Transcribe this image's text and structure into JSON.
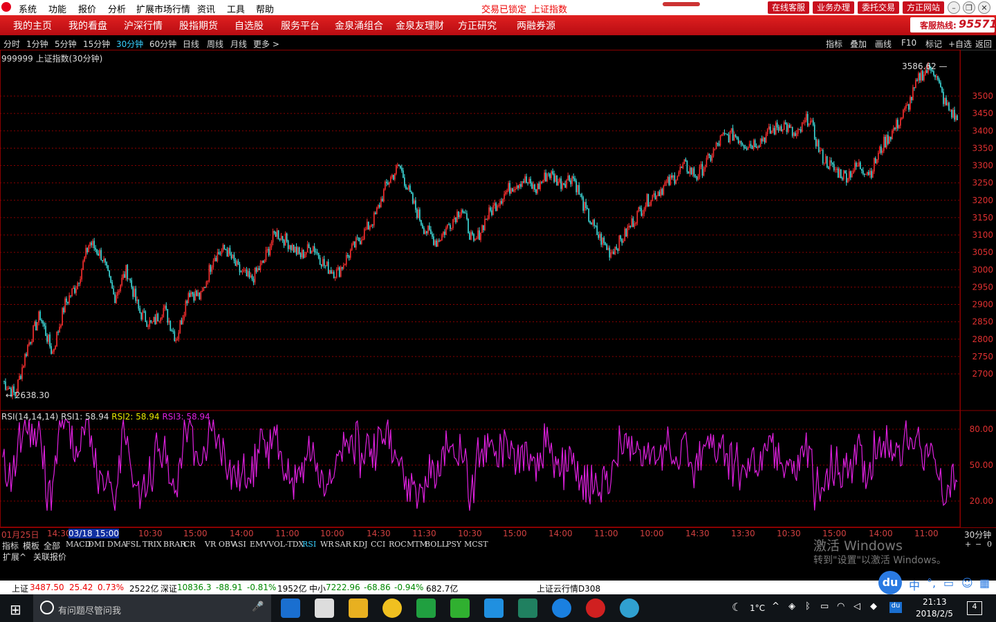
{
  "menu": {
    "items": [
      "系统",
      "功能",
      "报价",
      "分析",
      "扩展市场行情",
      "资讯",
      "工具",
      "帮助"
    ],
    "status_locked": "交易已锁定",
    "status_index": "上证指数",
    "buttons": [
      "在线客服",
      "业务办理",
      "委托交易",
      "方正网站"
    ]
  },
  "nav": {
    "items": [
      "我的主页",
      "我的看盘",
      "沪深行情",
      "股指期货",
      "自选股",
      "服务平台",
      "金泉涌组合",
      "金泉友理财",
      "方正研究",
      "两融券源"
    ],
    "hotline_label": "客服热线:",
    "hotline_number": "95571"
  },
  "periods": {
    "items": [
      "分时",
      "1分钟",
      "5分钟",
      "15分钟",
      "30分钟",
      "60分钟",
      "日线",
      "周线",
      "月线",
      "更多 >"
    ],
    "active": "30分钟",
    "tools": [
      "指标",
      "叠加",
      "画线",
      "F10",
      "标记",
      "+自选",
      "返回"
    ]
  },
  "chart_data": [
    {
      "type": "candlestick",
      "title": "999999 上证指数(30分钟)",
      "ylim": [
        2600,
        3620
      ],
      "y_ticks": [
        "3500",
        "3450",
        "3400",
        "3350",
        "3300",
        "3250",
        "3200",
        "3150",
        "3100",
        "3050",
        "3000",
        "2950",
        "2900",
        "2850",
        "2800",
        "2750",
        "2700"
      ],
      "high_label": "3586.62",
      "low_label": "2638.30",
      "approx_path": [
        2680,
        2640,
        2780,
        2870,
        2760,
        2900,
        2960,
        3080,
        3040,
        2920,
        3000,
        2880,
        2840,
        2890,
        2800,
        2940,
        2920,
        3040,
        3060,
        3000,
        2970,
        3020,
        3110,
        3080,
        3040,
        3070,
        3010,
        2990,
        3050,
        3100,
        3150,
        3250,
        3300,
        3200,
        3120,
        3080,
        3130,
        3180,
        3070,
        3150,
        3200,
        3240,
        3260,
        3230,
        3280,
        3250,
        3270,
        3170,
        3100,
        3050,
        3090,
        3150,
        3200,
        3230,
        3260,
        3300,
        3270,
        3320,
        3380,
        3390,
        3360,
        3370,
        3400,
        3420,
        3380,
        3440,
        3330,
        3290,
        3270,
        3300,
        3280,
        3360,
        3410,
        3470,
        3560,
        3586,
        3480,
        3430
      ]
    },
    {
      "type": "line",
      "title": "RSI(14,14,14)",
      "series": [
        {
          "name": "RSI1: 58.94",
          "color": "#dddddd"
        },
        {
          "name": "RSI2: 58.94",
          "color": "#e8e800"
        },
        {
          "name": "RSI3: 58.94",
          "color": "#e020e0"
        }
      ],
      "y_ticks": [
        "80.00",
        "50.00",
        "20.00"
      ],
      "ylim": [
        0,
        100
      ]
    }
  ],
  "time_axis": [
    "01月25日",
    "14:30",
    "03/18 15:00",
    "10:30",
    "15:00",
    "14:00",
    "11:00",
    "10:00",
    "14:30",
    "11:30",
    "10:30",
    "15:00",
    "14:00",
    "11:00",
    "10:00",
    "14:30",
    "13:30",
    "10:30",
    "15:00",
    "14:00",
    "11:00"
  ],
  "period_label": "30分钟",
  "indicators": [
    "指标",
    "模板",
    "全部",
    "MACD",
    "DMI",
    "DMA",
    "FSL",
    "TRIX",
    "BRAR",
    "CR",
    "VR",
    "OBV",
    "ASI",
    "EMV",
    "VOL-TDX",
    "RSI",
    "WR",
    "SAR",
    "KDJ",
    "CCI",
    "ROC",
    "MTM",
    "BOLL",
    "PSY",
    "MCST"
  ],
  "indicator_active": "RSI",
  "ext_tabs": [
    "扩展^",
    "关联报价"
  ],
  "watermark": {
    "line1": "激活 Windows",
    "line2": "转到\"设置\"以激活 Windows。"
  },
  "ticker": {
    "sh_label": "上证",
    "sh_value": "3487.50",
    "sh_change": "25.42",
    "sh_pct": "0.73%",
    "sh_vol": "2522亿",
    "sz_label": "深证",
    "sz_value": "10836.3",
    "sz_change": "-88.91",
    "sz_pct": "-0.81%",
    "sz_vol": "1952亿",
    "zx_label": "中小",
    "zx_value": "7222.96",
    "zx_change": "-68.86",
    "zx_pct": "-0.94%",
    "zx_vol": "682.7亿",
    "cloud": "上证云行情D308"
  },
  "taskbar": {
    "search_placeholder": "有问题尽管问我",
    "weather": "1°C",
    "time": "21:13",
    "date": "2018/2/5",
    "notifications": "4",
    "ime": "中"
  },
  "colors": {
    "up": "#ff3030",
    "down": "#40e0e0",
    "rsi": "#e020e0",
    "grid": "#8b0000"
  }
}
